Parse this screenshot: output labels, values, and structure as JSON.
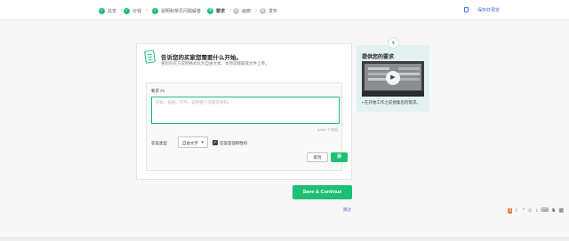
{
  "steps": [
    {
      "label": "总览",
      "status": "done"
    },
    {
      "label": "价钱",
      "status": "done"
    },
    {
      "label": "说明和常见问题解答",
      "status": "done"
    },
    {
      "label": "要求",
      "status": "current",
      "number": "4"
    },
    {
      "label": "画廊",
      "status": "todo",
      "number": "5"
    },
    {
      "label": "发布",
      "status": "todo",
      "number": "6"
    }
  ],
  "topbar": {
    "save_preview": "保存并预览"
  },
  "card": {
    "title": "告诉您的买家您需要什么开始。",
    "subtitle": "将您的买方说明格式化为自由文本，本项选择题或文件上传。",
    "requirement_label": "要求 #1",
    "textarea_placeholder": "例如，视频、打字、说明客户的需求材料。",
    "char_count": "0/450 个字符",
    "category_label": "答案类型",
    "category_value": "自由文字",
    "mandatory_label": "答案是强制性的",
    "cancel": "取消",
    "add": "添"
  },
  "help": {
    "title": "提供您的要求",
    "bullet": "在开始工作之前搜集您的需求。"
  },
  "save_continue": "Save & Continue",
  "skip": "跳过",
  "tray": {
    "lang": "S"
  },
  "colors": {
    "accent": "#1dbf73",
    "link": "#446ee7",
    "help_bg": "#e3f1f0"
  }
}
